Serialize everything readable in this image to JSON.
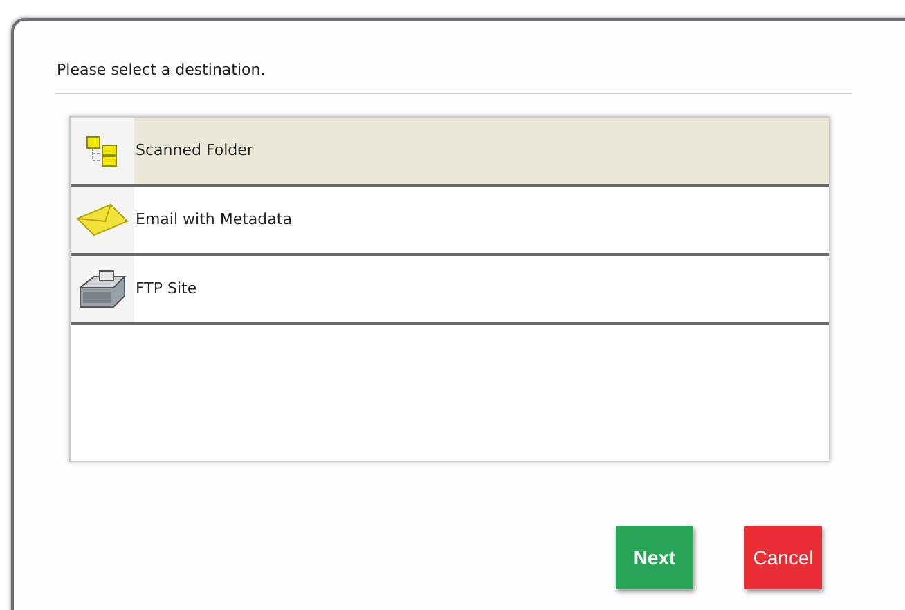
{
  "prompt": "Please select a destination.",
  "destinations": [
    {
      "label": "Scanned Folder",
      "kind": "folder",
      "selected": true
    },
    {
      "label": "Email with Metadata",
      "kind": "email",
      "selected": false
    },
    {
      "label": "FTP Site",
      "kind": "ftp",
      "selected": false
    }
  ],
  "buttons": [
    {
      "label": "Next",
      "kind": "next"
    },
    {
      "label": "Cancel",
      "kind": "cancel"
    }
  ]
}
